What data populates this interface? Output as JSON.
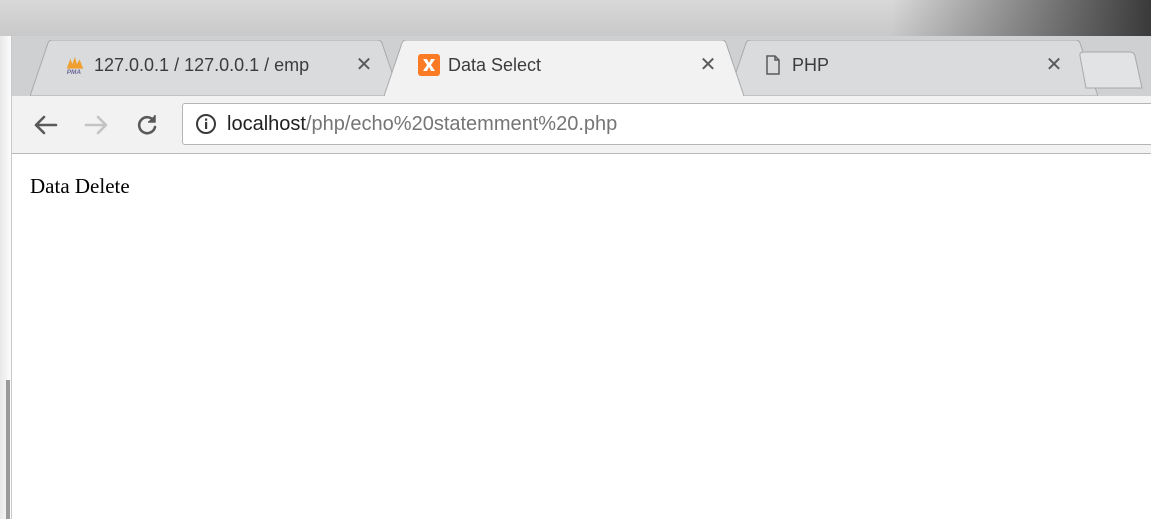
{
  "tabs": [
    {
      "title": "127.0.0.1 / 127.0.0.1 / emp",
      "icon": "phpmyadmin-logo-icon",
      "active": false
    },
    {
      "title": "Data Select",
      "icon": "xampp-logo-icon",
      "active": true
    },
    {
      "title": "PHP",
      "icon": "blank-page-icon",
      "active": false
    }
  ],
  "tab_close_glyph": "✕",
  "address_bar": {
    "host": "localhost",
    "path": "/php/echo%20statemment%20.php"
  },
  "page": {
    "body_text": "Data Delete"
  },
  "colors": {
    "tab_strip": "#cfd0d2",
    "active_tab": "#f2f2f2",
    "xampp_orange": "#fb7a24"
  }
}
